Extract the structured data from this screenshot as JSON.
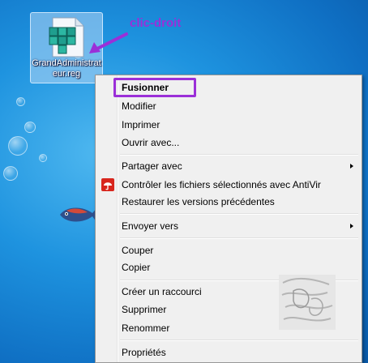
{
  "desktop": {
    "file": {
      "label": "GrandAdministrateur.reg",
      "icon": "registry-file-icon"
    },
    "colors": {
      "background": "#1e93df",
      "menu_bg": "#f0f0f0",
      "annotation": "#9b2fd8"
    }
  },
  "annotation": {
    "text": "clic-droit"
  },
  "context_menu": {
    "items": [
      {
        "label": "Fusionner",
        "bold": true
      },
      {
        "label": "Modifier"
      },
      {
        "label": "Imprimer"
      },
      {
        "label": "Ouvrir avec..."
      },
      {
        "label": "Partager avec",
        "submenu": true
      },
      {
        "label": "Contrôler les fichiers sélectionnés avec AntiVir",
        "icon": "antivir-umbrella-icon"
      },
      {
        "label": "Restaurer les versions précédentes"
      },
      {
        "label": "Envoyer vers",
        "submenu": true
      },
      {
        "label": "Couper"
      },
      {
        "label": "Copier"
      },
      {
        "label": "Créer un raccourci"
      },
      {
        "label": "Supprimer"
      },
      {
        "label": "Renommer"
      },
      {
        "label": "Propriétés"
      }
    ]
  }
}
